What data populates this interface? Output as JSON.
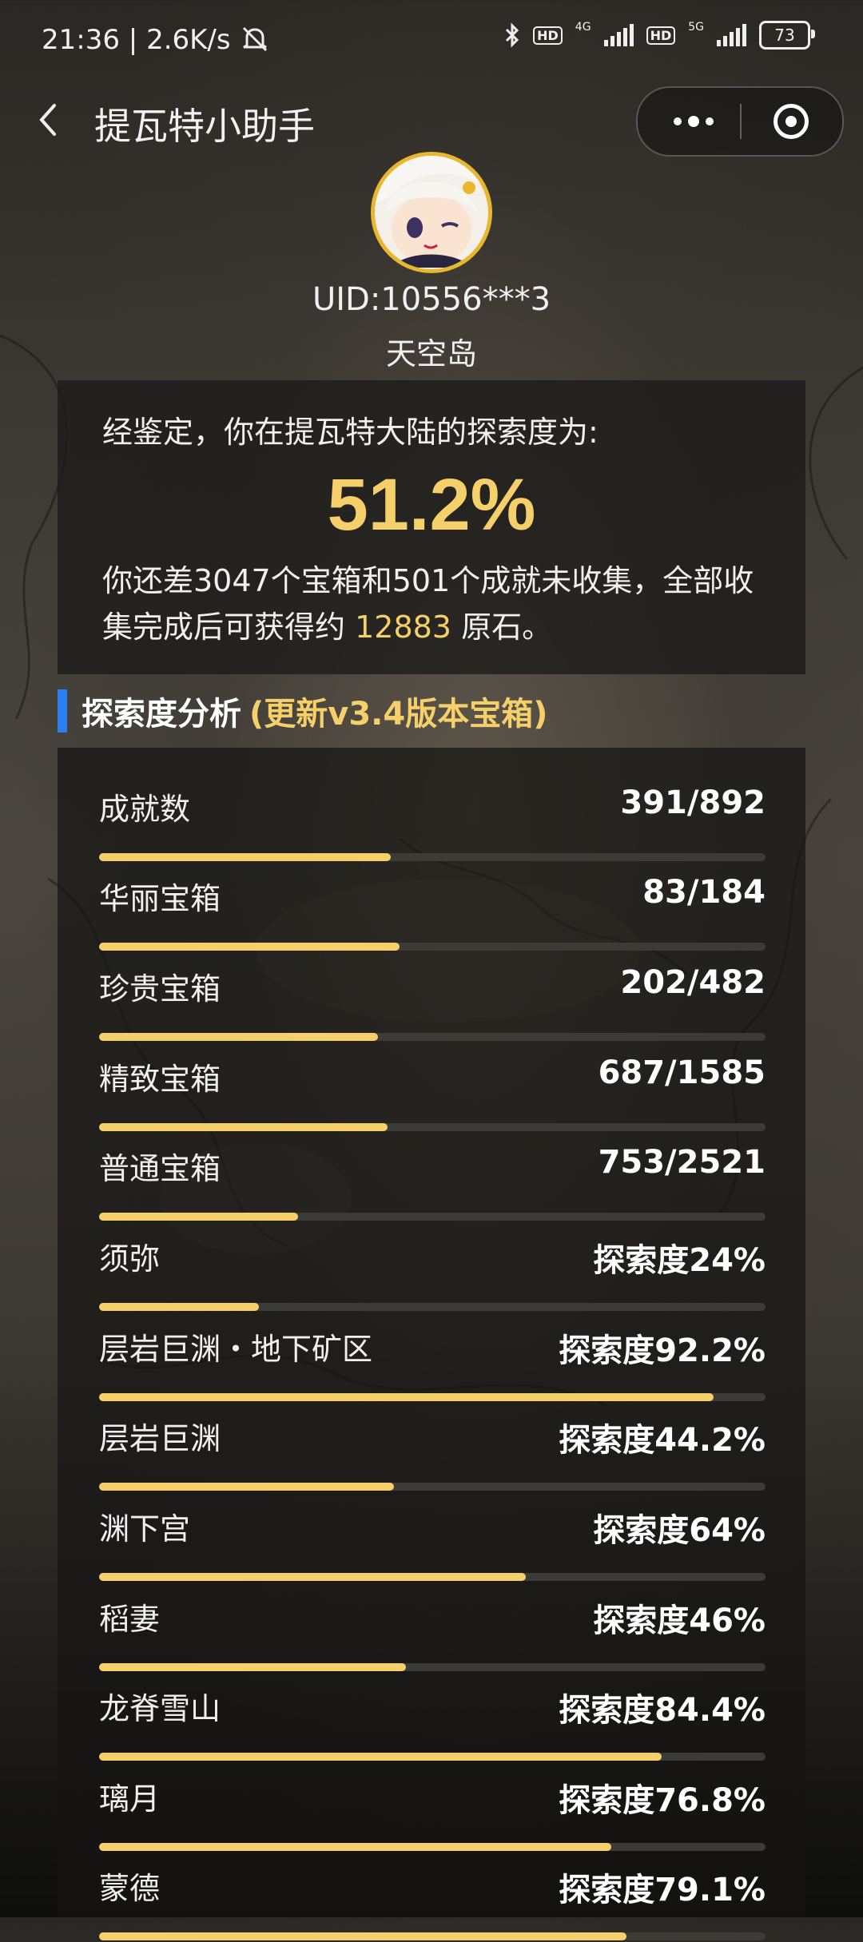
{
  "status_bar": {
    "time": "21:36",
    "speed": "2.6K/s",
    "hd1": "HD",
    "net1": "4G",
    "hd2": "HD",
    "net2": "5G",
    "battery": "73"
  },
  "nav": {
    "title": "提瓦特小助手"
  },
  "profile": {
    "uid": "UID:10556***3",
    "server": "天空岛"
  },
  "summary": {
    "lead": "经鉴定，你在提瓦特大陆的探索度为:",
    "percent": "51.2%",
    "desc_part1": "你还差3047个宝箱和501个成就未收集，全部收集完成后可获得约 ",
    "primogems": "12883",
    "desc_part2": " 原石。"
  },
  "section": {
    "title": "探索度分析",
    "note": "(更新v3.4版本宝箱)"
  },
  "stats": [
    {
      "label": "成就数",
      "value": "391/892",
      "progress": 0.438
    },
    {
      "label": "华丽宝箱",
      "value": "83/184",
      "progress": 0.451
    },
    {
      "label": "珍贵宝箱",
      "value": "202/482",
      "progress": 0.419
    },
    {
      "label": "精致宝箱",
      "value": "687/1585",
      "progress": 0.433
    },
    {
      "label": "普通宝箱",
      "value": "753/2521",
      "progress": 0.299
    },
    {
      "label": "须弥",
      "value": "探索度24%",
      "progress": 0.24
    },
    {
      "label": "层岩巨渊・地下矿区",
      "value": "探索度92.2%",
      "progress": 0.922
    },
    {
      "label": "层岩巨渊",
      "value": "探索度44.2%",
      "progress": 0.442
    },
    {
      "label": "渊下宫",
      "value": "探索度64%",
      "progress": 0.64
    },
    {
      "label": "稻妻",
      "value": "探索度46%",
      "progress": 0.46
    },
    {
      "label": "龙脊雪山",
      "value": "探索度84.4%",
      "progress": 0.844
    },
    {
      "label": "璃月",
      "value": "探索度76.8%",
      "progress": 0.768
    },
    {
      "label": "蒙德",
      "value": "探索度79.1%",
      "progress": 0.791
    }
  ],
  "colors": {
    "accent_gold": "#f5cf6a",
    "section_marker": "#2d7ff0"
  },
  "icons": {
    "back": "chevron-left-icon",
    "more": "more-dots-icon",
    "close": "target-circle-icon"
  }
}
